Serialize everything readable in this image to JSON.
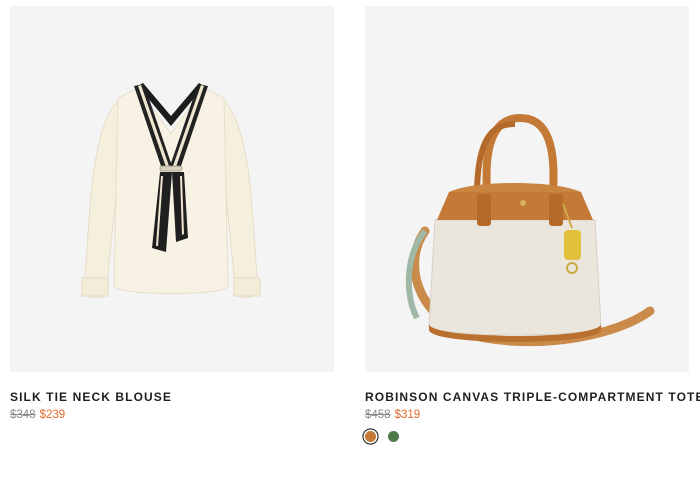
{
  "products": [
    {
      "name": "SILK TIE NECK BLOUSE",
      "original_price": "$348",
      "sale_price": "$239",
      "image_icon": "blouse-image"
    },
    {
      "name": "ROBINSON CANVAS TRIPLE-COMPARTMENT TOTE",
      "original_price": "$458",
      "sale_price": "$319",
      "image_icon": "tote-bag-image",
      "swatches": [
        {
          "color": "#c47a36",
          "selected": true
        },
        {
          "color": "#4e7a4a",
          "selected": false
        }
      ]
    }
  ],
  "colors": {
    "sale": "#e46a2b",
    "original": "#8a8a8a",
    "image_bg": "#f4f4f4"
  }
}
